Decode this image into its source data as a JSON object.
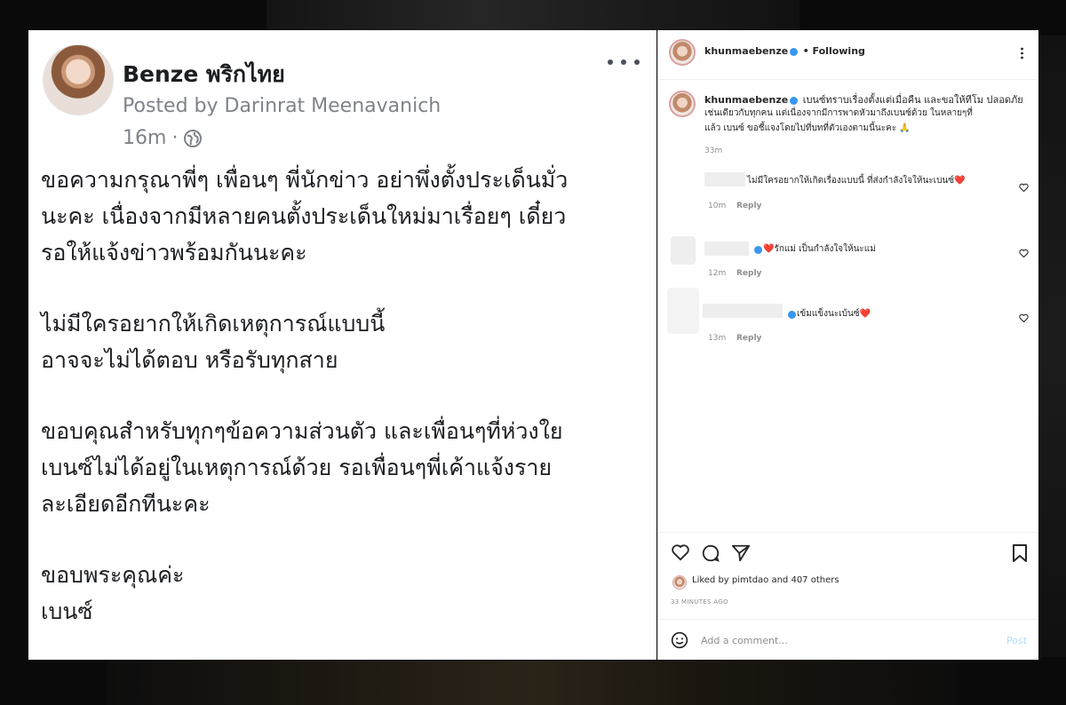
{
  "facebook": {
    "author_name": "Benze พริกไทย",
    "posted_by": "Posted by Darinrat Meenavanich",
    "time": "16m",
    "separator": "·",
    "body_paragraphs": [
      [
        "ขอความกรุณาพี่ๆ เพื่อนๆ พี่นักข่าว อย่าพึ่งตั้งประเด็นมั่ว",
        "นะคะ เนื่องจากมีหลายคนตั้งประเด็นใหม่มาเรื่อยๆ เดี๋ยว",
        "รอให้แจ้งข่าวพร้อมกันนะคะ"
      ],
      [
        "ไม่มีใครอยากให้เกิดเหตุการณ์แบบนี้",
        "อาจจะไม่ได้ตอบ หรือรับทุกสาย"
      ],
      [
        "ขอบคุณสำหรับทุกๆข้อความส่วนตัว และเพื่อนๆที่ห่วงใย",
        "เบนซ์ไม่ได้อยู่ในเหตุการณ์ด้วย รอเพื่อนๆพี่เค้าแจ้งราย",
        "ละเอียดอีกทีนะคะ"
      ],
      [
        "ขอบพระคุณค่ะ",
        "เบนซ์"
      ]
    ]
  },
  "instagram": {
    "header_username": "khunmaebenze",
    "header_follow": "• Following",
    "caption_username": "khunmaebenze",
    "caption_lines": [
      "เบนซ์ทราบเรื่องตั้งแต่เมื่อคืน และขอให้ทีโม ปลอดภัย",
      "เช่นเดียวกับทุกคน แต่เนื่องจากมีการพาดหัวมาถึงเบนซ์ด้วย ในหลายๆที่",
      "แล้ว เบนซ์ ขอชี้แจงโดยไปที่บทที่ตัวเองตามนี้นะคะ 🙏"
    ],
    "caption_time": "33m",
    "comments": [
      {
        "text": "ไม่มีใครอยากให้เกิดเรื่องแบบนี้ ที่ส่งกำลังใจให้นะเบนซ์❤️",
        "time": "10m",
        "reply": "Reply"
      },
      {
        "text": "❤️รักแม่ เป็นกำลังใจให้นะแม่",
        "time": "12m",
        "reply": "Reply"
      },
      {
        "text": "เข้มแข็งนะเบ้นซ์❤️",
        "time": "13m",
        "reply": "Reply"
      }
    ],
    "liked_by": "Liked by pimtdao and 407 others",
    "timestamp": "33 MINUTES AGO",
    "comment_placeholder": "Add a comment...",
    "post_label": "Post"
  }
}
